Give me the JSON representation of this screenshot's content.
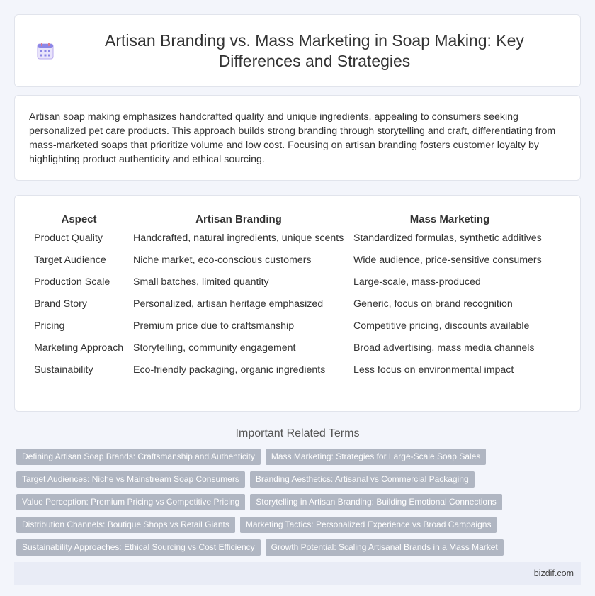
{
  "header": {
    "title": "Artisan Branding vs. Mass Marketing in Soap Making: Key Differences and Strategies",
    "icon": "calendar-grid-icon"
  },
  "intro": {
    "text": "Artisan soap making emphasizes handcrafted quality and unique ingredients, appealing to consumers seeking personalized pet care products. This approach builds strong branding through storytelling and craft, differentiating from mass-marketed soaps that prioritize volume and low cost. Focusing on artisan branding fosters customer loyalty by highlighting product authenticity and ethical sourcing."
  },
  "table": {
    "headers": [
      "Aspect",
      "Artisan Branding",
      "Mass Marketing"
    ],
    "rows": [
      [
        "Product Quality",
        "Handcrafted, natural ingredients, unique scents",
        "Standardized formulas, synthetic additives"
      ],
      [
        "Target Audience",
        "Niche market, eco-conscious customers",
        "Wide audience, price-sensitive consumers"
      ],
      [
        "Production Scale",
        "Small batches, limited quantity",
        "Large-scale, mass-produced"
      ],
      [
        "Brand Story",
        "Personalized, artisan heritage emphasized",
        "Generic, focus on brand recognition"
      ],
      [
        "Pricing",
        "Premium price due to craftsmanship",
        "Competitive pricing, discounts available"
      ],
      [
        "Marketing Approach",
        "Storytelling, community engagement",
        "Broad advertising, mass media channels"
      ],
      [
        "Sustainability",
        "Eco-friendly packaging, organic ingredients",
        "Less focus on environmental impact"
      ]
    ]
  },
  "related": {
    "title": "Important Related Terms",
    "tags": [
      [
        "Defining Artisan Soap Brands: Craftsmanship and Authenticity",
        "Mass Marketing: Strategies for Large-Scale Soap Sales"
      ],
      [
        "Target Audiences: Niche vs Mainstream Soap Consumers",
        "Branding Aesthetics: Artisanal vs Commercial Packaging"
      ],
      [
        "Value Perception: Premium Pricing vs Competitive Pricing",
        "Storytelling in Artisan Branding: Building Emotional Connections"
      ],
      [
        "Distribution Channels: Boutique Shops vs Retail Giants",
        "Marketing Tactics: Personalized Experience vs Broad Campaigns"
      ],
      [
        "Sustainability Approaches: Ethical Sourcing vs Cost Efficiency",
        "Growth Potential: Scaling Artisanal Brands in a Mass Market"
      ]
    ]
  },
  "footer": {
    "site": "bizdif.com"
  }
}
